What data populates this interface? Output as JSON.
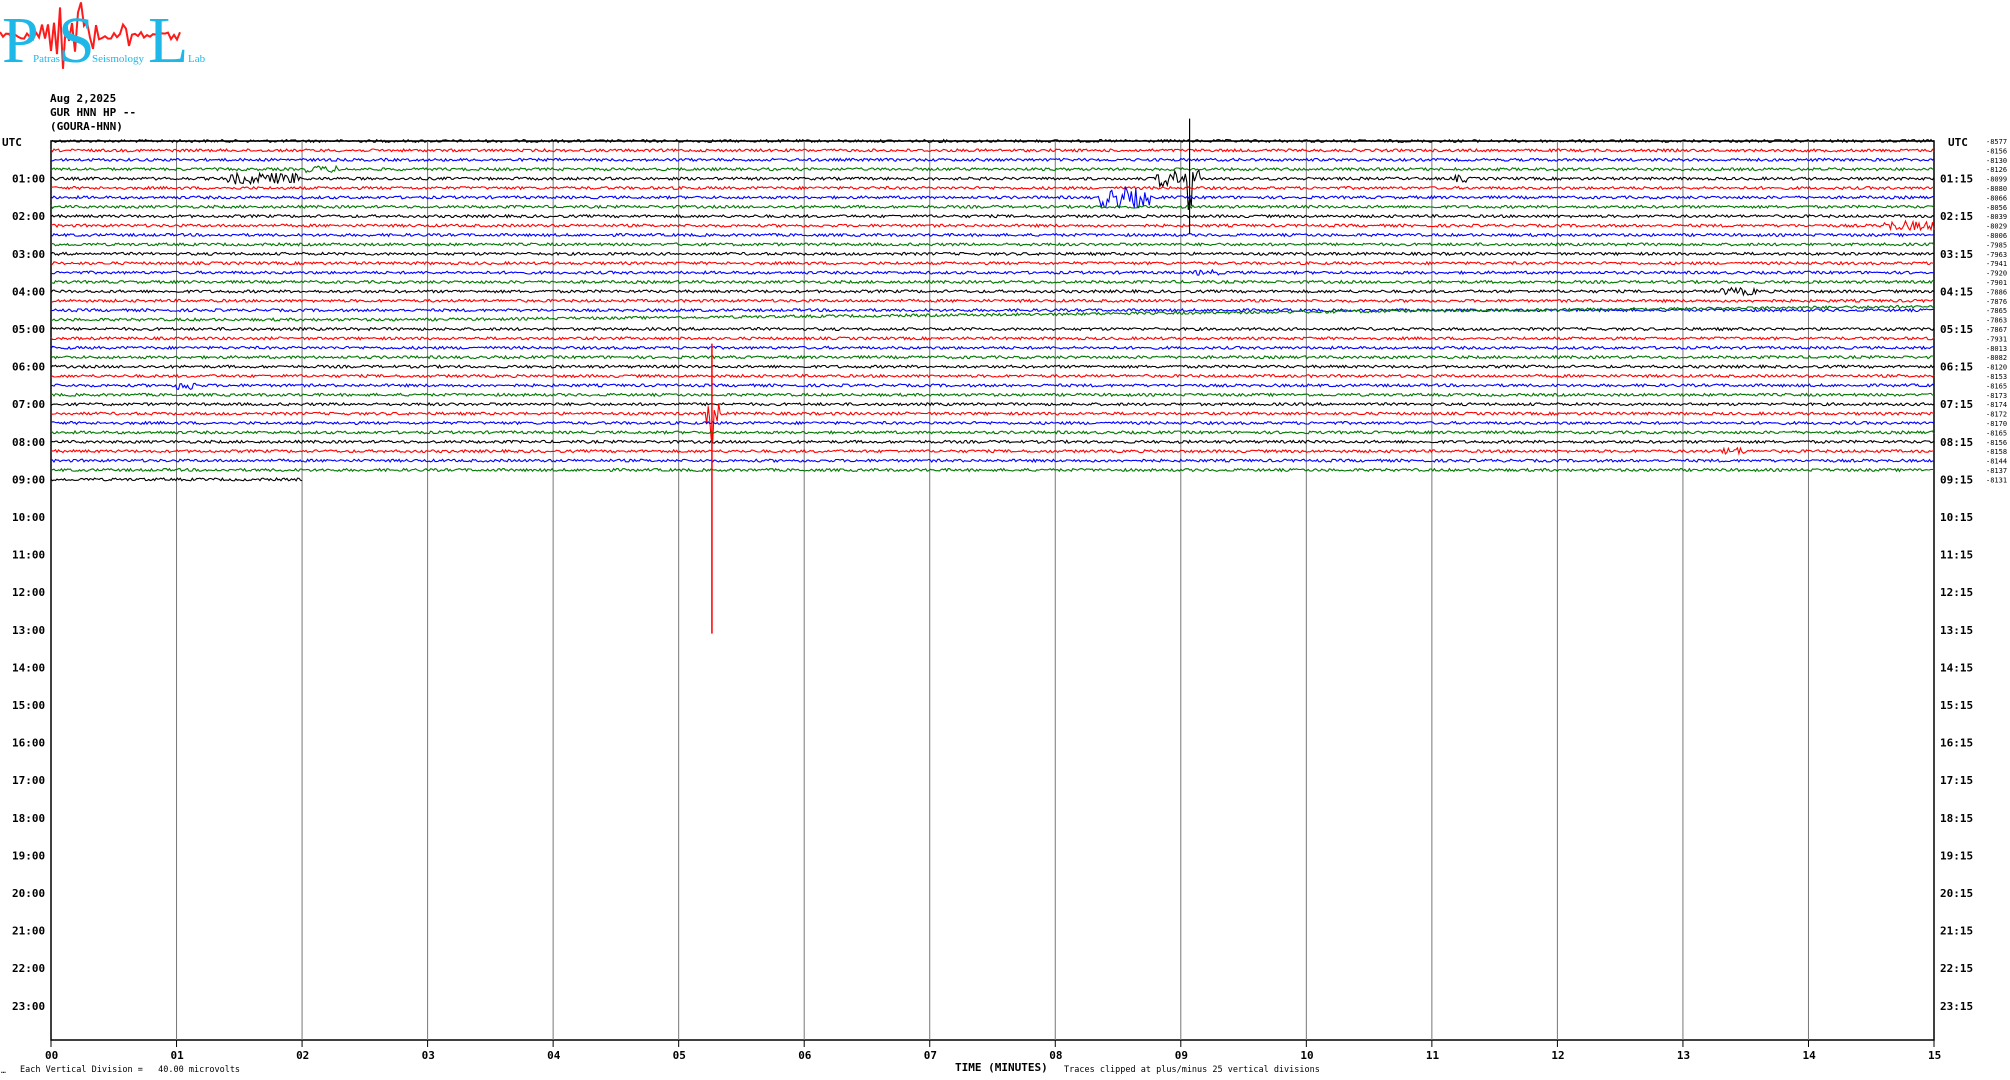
{
  "logo": {
    "letters": [
      "P",
      "S",
      "L"
    ],
    "words": [
      "Patras",
      "Seismology",
      "Lab"
    ],
    "color_letters": "#1EB8E8",
    "color_trace": "#FF1A1A"
  },
  "header": {
    "date": "Aug 2,2025",
    "channel": "GUR HNN HP --",
    "station": "(GOURA-HNN)"
  },
  "axis": {
    "left_label": "UTC",
    "right_label": "UTC",
    "left_hours": [
      "01:00",
      "02:00",
      "03:00",
      "04:00",
      "05:00",
      "06:00",
      "07:00",
      "08:00",
      "09:00",
      "10:00",
      "11:00",
      "12:00",
      "13:00",
      "14:00",
      "15:00",
      "16:00",
      "17:00",
      "18:00",
      "19:00",
      "20:00",
      "21:00",
      "22:00",
      "23:00"
    ],
    "right_hours": [
      "01:15",
      "02:15",
      "03:15",
      "04:15",
      "05:15",
      "06:15",
      "07:15",
      "08:15",
      "09:15",
      "10:15",
      "11:15",
      "12:15",
      "13:15",
      "14:15",
      "15:15",
      "16:15",
      "17:15",
      "18:15",
      "19:15",
      "20:15",
      "21:15",
      "22:15",
      "23:15"
    ],
    "minute_ticks": [
      "00",
      "01",
      "02",
      "03",
      "04",
      "05",
      "06",
      "07",
      "08",
      "09",
      "10",
      "11",
      "12",
      "13",
      "14",
      "15"
    ],
    "x_label": "TIME (MINUTES)",
    "scale_note": "Each Vertical Division =   40.00 microvolts",
    "clip_note": "Traces clipped at plus/minus 25 vertical divisions",
    "corner_mark": "…"
  },
  "chart_data": {
    "type": "line",
    "subtype": "helicorder",
    "x_axis": "minutes",
    "xlim": [
      0,
      15
    ],
    "rows_per_hour": 4,
    "total_rows": 96,
    "recorded_rows": 37,
    "last_row_minutes": 2,
    "color_cycle": [
      "#000000",
      "#FF0000",
      "#0000FF",
      "#007700"
    ],
    "grid": true,
    "row_offsets": [
      "-8577",
      "-8156",
      "-8130",
      "-8126",
      "-8099",
      "-8080",
      "-8066",
      "-8056",
      "-8039",
      "-8029",
      "-8006",
      "-7985",
      "-7963",
      "-7941",
      "-7920",
      "-7901",
      "-7886",
      "-7876",
      "-7865",
      "-7863",
      "-7867",
      "-7931",
      "-8013",
      "-8082",
      "-8120",
      "-8153",
      "-8165",
      "-8173",
      "-8174",
      "-8172",
      "-8170",
      "-8165",
      "-8156",
      "-8158",
      "-8144",
      "-8137",
      "-8131"
    ],
    "events": [
      {
        "row": 4,
        "minute_start": 1.4,
        "minute_end": 2.0,
        "amplitude": 0.6
      },
      {
        "row": 3,
        "minute_start": 2.0,
        "minute_end": 2.3,
        "amplitude": 0.35
      },
      {
        "row": 6,
        "minute_start": 8.35,
        "minute_end": 8.75,
        "amplitude": 1.1
      },
      {
        "row": 4,
        "minute_start": 8.8,
        "minute_end": 9.15,
        "amplitude": 0.9
      },
      {
        "row": 4,
        "minute_start": 9.04,
        "minute_end": 9.1,
        "amplitude": 3.5
      },
      {
        "row": 4,
        "minute_start": 11.18,
        "minute_end": 11.28,
        "amplitude": 0.4
      },
      {
        "row": 9,
        "minute_start": 14.6,
        "minute_end": 15.0,
        "amplitude": 0.5
      },
      {
        "row": 26,
        "minute_start": 1.0,
        "minute_end": 1.15,
        "amplitude": 0.5
      },
      {
        "row": 29,
        "minute_start": 5.22,
        "minute_end": 5.32,
        "amplitude": 1.2
      },
      {
        "row": 29,
        "minute_start": 5.25,
        "minute_end": 5.28,
        "amplitude": 10.0
      },
      {
        "row": 33,
        "minute_start": 13.3,
        "minute_end": 13.5,
        "amplitude": 0.4
      },
      {
        "row": 14,
        "minute_start": 9.1,
        "minute_end": 9.3,
        "amplitude": 0.3
      },
      {
        "row": 16,
        "minute_start": 13.3,
        "minute_end": 13.6,
        "amplitude": 0.4
      }
    ],
    "drift": {
      "row": 19,
      "minute_start": 3.0,
      "minute_end": 15.0,
      "shift_rows": 1.4
    }
  }
}
